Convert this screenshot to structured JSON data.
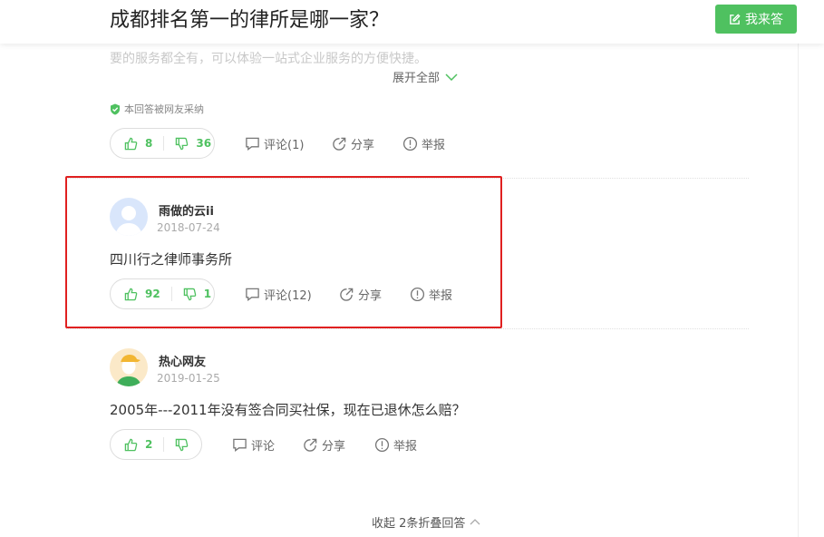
{
  "header": {
    "title": "成都排名第一的律所是哪一家？",
    "answer_button": "我来答"
  },
  "prev_answer": {
    "faded_text": "要的服务都全有，可以体验一站式企业服务的方便快捷。",
    "expand_all": "展开全部",
    "adopted_label": "本回答被网友采纳",
    "likes": "8",
    "dislikes": "36",
    "comment": "评论(1)",
    "share": "分享",
    "report": "举报"
  },
  "answer1": {
    "user": "雨做的云ii",
    "date": "2018-07-24",
    "text": "四川行之律师事务所",
    "likes": "92",
    "dislikes": "1",
    "comment": "评论(12)",
    "share": "分享",
    "report": "举报"
  },
  "answer2": {
    "user": "热心网友",
    "date": "2019-01-25",
    "text": "2005年---2011年没有签合同买社保，现在已退休怎么赔？",
    "likes": "2",
    "dislikes": "",
    "comment": "评论",
    "share": "分享",
    "report": "举报"
  },
  "footer": {
    "collapse": "收起 2条折叠回答"
  },
  "colors": {
    "accent": "#4fc160",
    "highlight": "#e02020"
  }
}
